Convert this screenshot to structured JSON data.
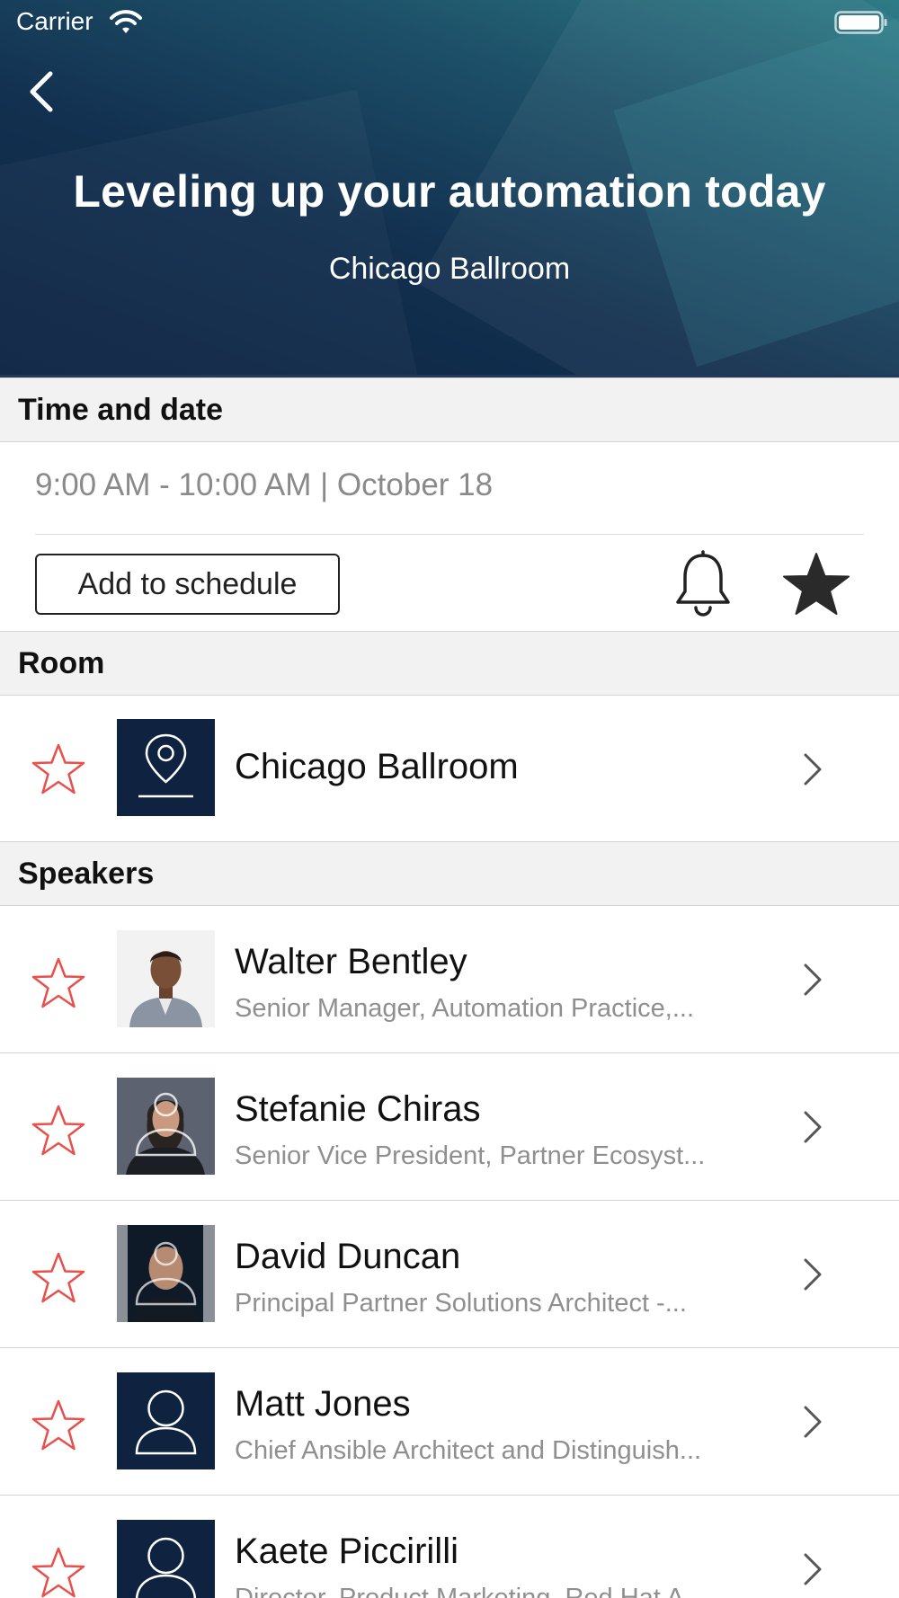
{
  "status_bar": {
    "carrier": "Carrier"
  },
  "session": {
    "title": "Leveling up your automation today",
    "location": "Chicago Ballroom"
  },
  "sections": {
    "time_date": "Time and date",
    "room": "Room",
    "speakers": "Speakers"
  },
  "time": {
    "text": "9:00 AM - 10:00 AM | October 18",
    "add_label": "Add to schedule"
  },
  "room": {
    "name": "Chicago Ballroom"
  },
  "speakers": [
    {
      "name": "Walter Bentley",
      "title": "Senior Manager, Automation Practice,..."
    },
    {
      "name": "Stefanie Chiras",
      "title": "Senior Vice President, Partner Ecosyst..."
    },
    {
      "name": "David Duncan",
      "title": "Principal Partner Solutions Architect -..."
    },
    {
      "name": "Matt Jones",
      "title": "Chief Ansible Architect and Distinguish..."
    },
    {
      "name": "Kaete Piccirilli",
      "title": "Director, Product Marketing, Red Hat A..."
    }
  ],
  "colors": {
    "accent_star": "#e8504c",
    "tile_navy": "#0f2340"
  },
  "icons": {
    "back": "chevron-left-icon",
    "bell": "bell-icon",
    "favorite": "star-filled-icon",
    "row_favorite": "star-outline-icon",
    "room_tile": "map-pin-icon",
    "person": "person-icon",
    "row_chevron": "chevron-right-icon"
  }
}
